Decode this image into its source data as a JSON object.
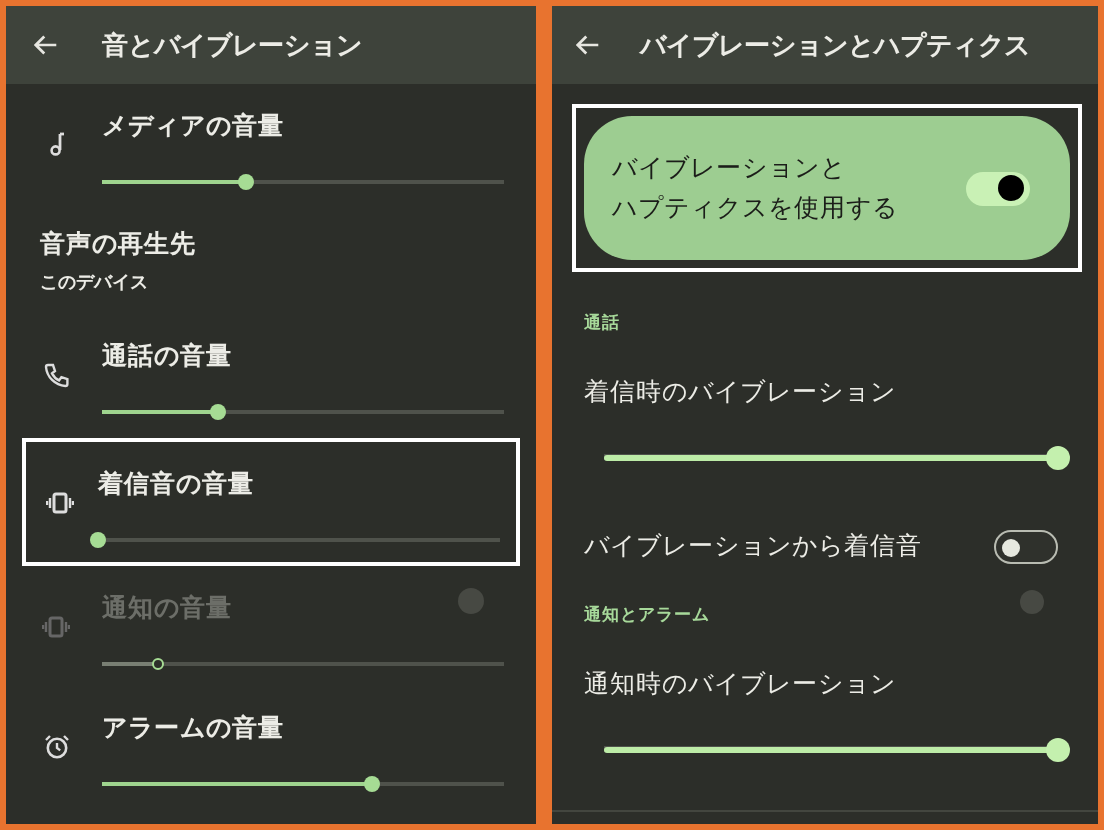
{
  "left_screen": {
    "title": "音とバイブレーション",
    "items": [
      {
        "kind": "slider",
        "title": "メディアの音量",
        "level": 0.36,
        "disabled": false,
        "highlighted": false
      },
      {
        "kind": "info",
        "title": "音声の再生先",
        "subtitle": "このデバイス"
      },
      {
        "kind": "slider",
        "title": "通話の音量",
        "level": 0.29,
        "disabled": false,
        "highlighted": false
      },
      {
        "kind": "slider",
        "title": "着信音の音量",
        "level": 0,
        "disabled": false,
        "highlighted": true
      },
      {
        "kind": "slider",
        "title": "通知の音量",
        "level": 0.14,
        "disabled": true,
        "highlighted": false
      },
      {
        "kind": "slider",
        "title": "アラームの音量",
        "level": 0.67,
        "disabled": false,
        "highlighted": false
      }
    ]
  },
  "right_screen": {
    "title": "バイブレーションとハプティクス",
    "main_switch": {
      "label_lines": [
        "バイブレーションと",
        "ハプティクスを使用する"
      ],
      "on": true,
      "highlighted": true
    },
    "items": [
      {
        "kind": "section",
        "title": "通話"
      },
      {
        "kind": "slider",
        "title": "着信時のバイブレーション",
        "level": 1
      },
      {
        "kind": "switch",
        "title": "バイブレーションから着信音",
        "on": false
      },
      {
        "kind": "section",
        "title": "通知とアラーム"
      },
      {
        "kind": "slider",
        "title": "通知時のバイブレーション",
        "level": 1
      }
    ]
  }
}
